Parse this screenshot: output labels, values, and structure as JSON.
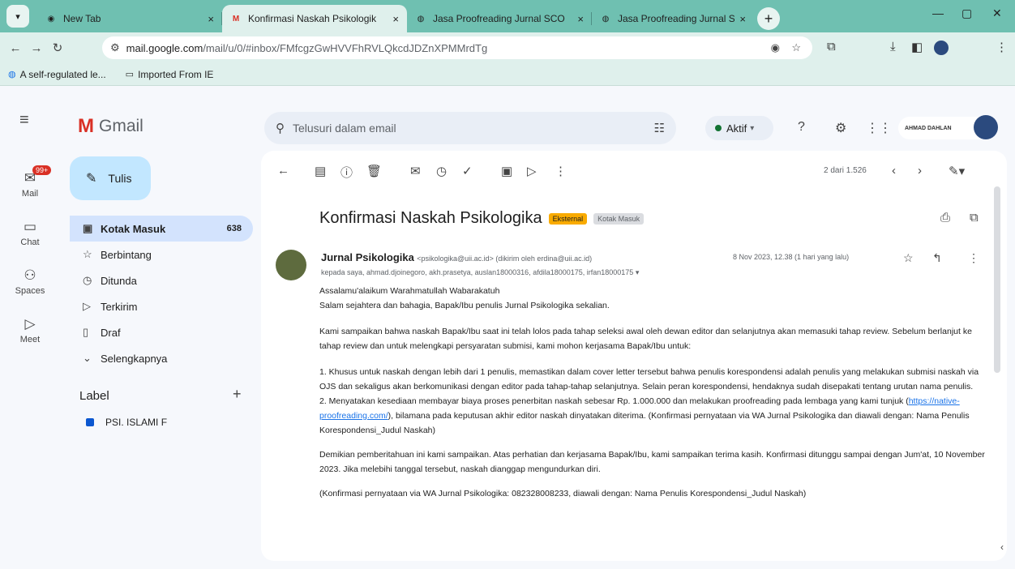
{
  "browser": {
    "tabs": [
      {
        "title": "New Tab",
        "favicon": "chrome-icon"
      },
      {
        "title": "Konfirmasi Naskah Psikologik",
        "favicon": "gmail-icon",
        "active": true
      },
      {
        "title": "Jasa Proofreading Jurnal SCO",
        "favicon": "globe-icon"
      },
      {
        "title": "Jasa Proofreading Jurnal SCO",
        "favicon": "globe-icon"
      }
    ],
    "url_host": "mail.google.com",
    "url_path": "/mail/u/0/#inbox/FMfcgzGwHVVFhRVLQkcdJDZnXPMMrdTg",
    "bookmarks": [
      "A self-regulated le...",
      "Imported From IE"
    ]
  },
  "gmail": {
    "logo": "Gmail",
    "rail": [
      {
        "label": "Mail",
        "badge": "99+"
      },
      {
        "label": "Chat"
      },
      {
        "label": "Spaces"
      },
      {
        "label": "Meet"
      }
    ],
    "compose": "Tulis",
    "nav": [
      {
        "label": "Kotak Masuk",
        "count": "638"
      },
      {
        "label": "Berbintang"
      },
      {
        "label": "Ditunda"
      },
      {
        "label": "Terkirim"
      },
      {
        "label": "Draf"
      },
      {
        "label": "Selengkapnya"
      }
    ],
    "labels_heading": "Label",
    "labels": [
      "PSI. ISLAMI F"
    ],
    "search_placeholder": "Telusuri dalam email",
    "status": "Aktif",
    "org_name": "AHMAD DAHLAN"
  },
  "email": {
    "pager": "2 dari 1.526",
    "subject": "Konfirmasi Naskah Psikologika",
    "chip_external": "Eksternal",
    "chip_inbox": "Kotak Masuk",
    "sender_name": "Jurnal Psikologika",
    "sender_email": "<psikologika@uii.ac.id> (dikirim oleh erdina@uii.ac.id)",
    "date": "8 Nov 2023, 12.38 (1 hari yang lalu)",
    "recipients": "kepada saya, ahmad.djoinegoro, akh.prasetya, auslan18000316, afdila18000175, irfan18000175",
    "greeting": "Assalamu'alaikum Warahmatullah Wabarakatuh",
    "salam": "Salam sejahtera dan bahagia, Bapak/Ibu penulis Jurnal Psikologika sekalian.",
    "para1": "Kami sampaikan bahwa naskah Bapak/Ibu saat ini telah lolos pada tahap seleksi awal oleh dewan editor dan selanjutnya akan memasuki tahap review. Sebelum berlanjut ke tahap review dan untuk melengkapi persyaratan submisi, kami mohon kerjasama Bapak/Ibu untuk:",
    "item1": "1. Khusus untuk naskah dengan lebih dari 1 penulis, memastikan dalam cover letter tersebut bahwa penulis korespondensi adalah penulis yang melakukan submisi naskah via OJS dan sekaligus akan berkomunikasi dengan editor pada tahap-tahap selanjutnya. Selain peran korespondensi, hendaknya sudah disepakati tentang urutan nama penulis.",
    "item2_a": "2. Menyatakan kesediaan membayar biaya proses penerbitan naskah sebesar Rp. 1.000.000 dan melakukan proofreading pada lembaga yang kami tunjuk (",
    "item2_link": "https://native-proofreading.com/",
    "item2_b": "), bilamana pada keputusan akhir editor naskah dinyatakan diterima. (Konfirmasi pernyataan via WA Jurnal Psikologika dan diawali dengan: Nama Penulis Korespondensi_Judul Naskah)",
    "para2": "Demikian pemberitahuan ini kami sampaikan. Atas perhatian dan kerjasama Bapak/Ibu, kami sampaikan terima kasih. Konfirmasi ditunggu sampai dengan Jum'at, 10 November 2023. Jika melebihi tanggal tersebut, naskah dianggap mengundurkan diri.",
    "para3": "(Konfirmasi pernyataan via WA Jurnal Psikologika: 082328008233, diawali dengan: Nama Penulis Korespondensi_Judul Naskah)"
  }
}
